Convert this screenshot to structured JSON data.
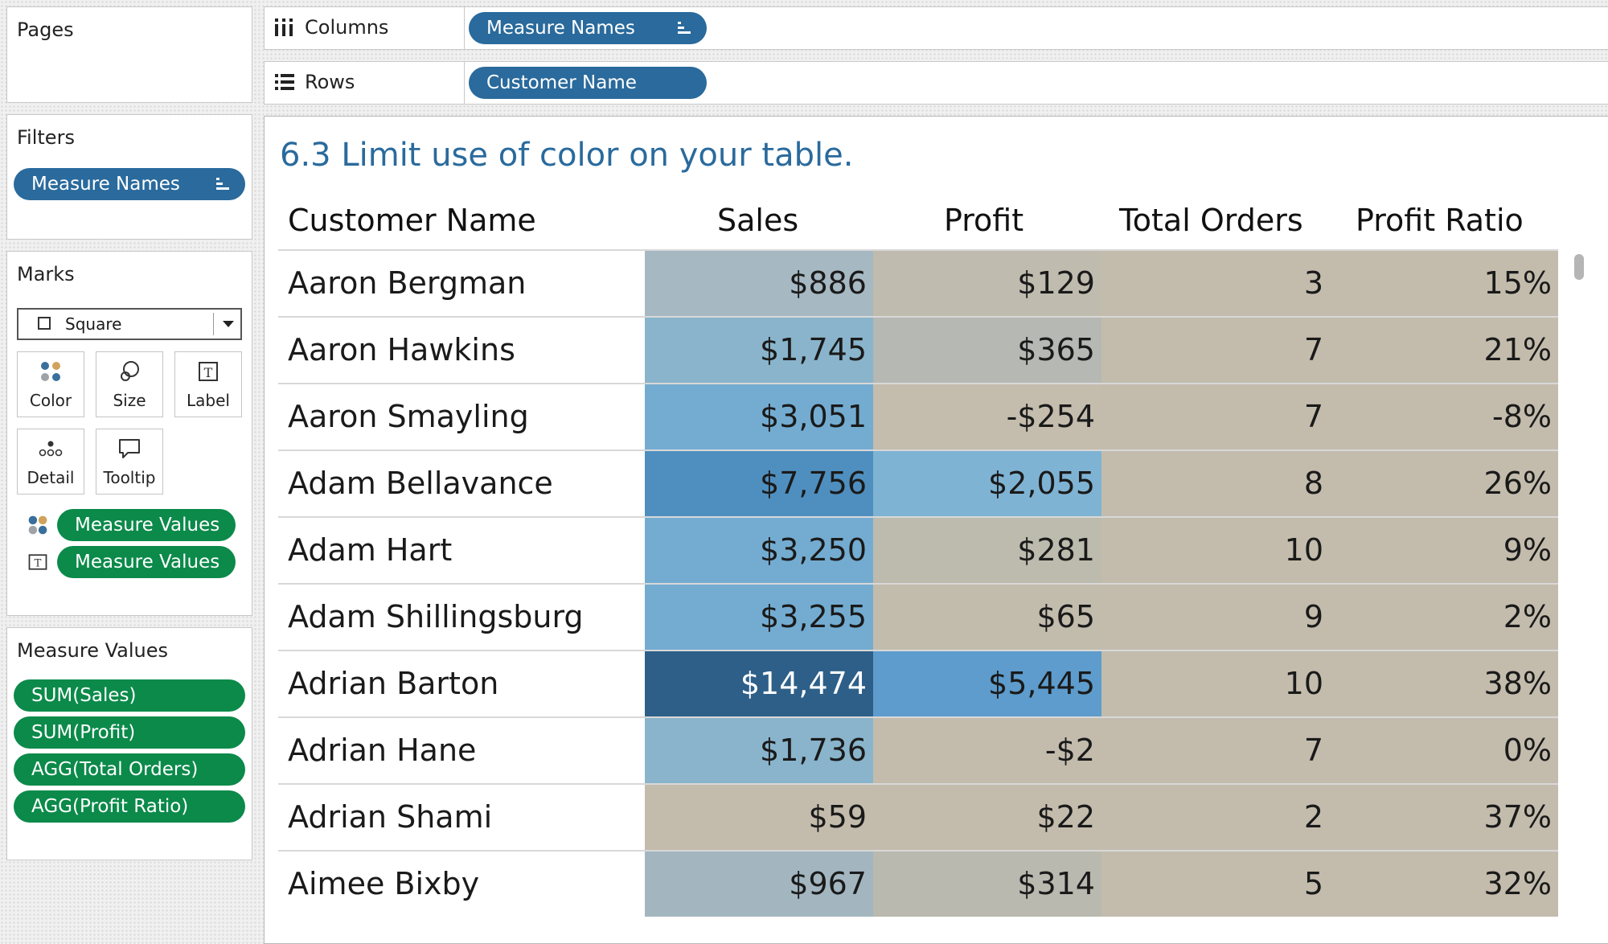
{
  "pages_panel": {
    "title": "Pages"
  },
  "filters_panel": {
    "title": "Filters",
    "pills": [
      "Measure Names"
    ]
  },
  "marks_panel": {
    "title": "Marks",
    "mark_type": "Square",
    "cards": [
      {
        "label": "Color",
        "icon": "color-dots-icon"
      },
      {
        "label": "Size",
        "icon": "size-icon"
      },
      {
        "label": "Label",
        "icon": "label-text-icon"
      },
      {
        "label": "Detail",
        "icon": "detail-dots-icon"
      },
      {
        "label": "Tooltip",
        "icon": "tooltip-icon"
      }
    ],
    "encodings": [
      {
        "icon": "color-dots-icon",
        "pill": "Measure Values"
      },
      {
        "icon": "label-text-icon",
        "pill": "Measure Values"
      }
    ]
  },
  "measure_values_panel": {
    "title": "Measure Values",
    "pills": [
      "SUM(Sales)",
      "SUM(Profit)",
      "AGG(Total Orders)",
      "AGG(Profit Ratio)"
    ]
  },
  "shelves": {
    "columns": {
      "label": "Columns",
      "pill": "Measure Names"
    },
    "rows": {
      "label": "Rows",
      "pill": "Customer Name"
    }
  },
  "viz": {
    "title": "6.3 Limit use of color on your table.",
    "headers": [
      "Customer Name",
      "Sales",
      "Profit",
      "Total Orders",
      "Profit Ratio"
    ],
    "rows": [
      {
        "name": "Aaron Bergman",
        "sales": "$886",
        "profit": "$129",
        "orders": "3",
        "ratio": "15%"
      },
      {
        "name": "Aaron Hawkins",
        "sales": "$1,745",
        "profit": "$365",
        "orders": "7",
        "ratio": "21%"
      },
      {
        "name": "Aaron Smayling",
        "sales": "$3,051",
        "profit": "-$254",
        "orders": "7",
        "ratio": "-8%"
      },
      {
        "name": "Adam Bellavance",
        "sales": "$7,756",
        "profit": "$2,055",
        "orders": "8",
        "ratio": "26%"
      },
      {
        "name": "Adam Hart",
        "sales": "$3,250",
        "profit": "$281",
        "orders": "10",
        "ratio": "9%"
      },
      {
        "name": "Adam Shillingsburg",
        "sales": "$3,255",
        "profit": "$65",
        "orders": "9",
        "ratio": "2%"
      },
      {
        "name": "Adrian Barton",
        "sales": "$14,474",
        "profit": "$5,445",
        "orders": "10",
        "ratio": "38%"
      },
      {
        "name": "Adrian Hane",
        "sales": "$1,736",
        "profit": "-$2",
        "orders": "7",
        "ratio": "0%"
      },
      {
        "name": "Adrian Shami",
        "sales": "$59",
        "profit": "$22",
        "orders": "2",
        "ratio": "37%"
      },
      {
        "name": "Aimee Bixby",
        "sales": "$967",
        "profit": "$314",
        "orders": "5",
        "ratio": "32%"
      }
    ],
    "cell_colors": [
      {
        "sales": "#a6b8c2",
        "profit": "#bfbbae"
      },
      {
        "sales": "#89b4cb",
        "profit": "#b5b8b3"
      },
      {
        "sales": "#74acd1",
        "profit": "#c4bcad"
      },
      {
        "sales": "#4f8fbf",
        "profit": "#7fb3d4"
      },
      {
        "sales": "#74acd1",
        "profit": "#bdbbae"
      },
      {
        "sales": "#74acd1",
        "profit": "#c2bcad"
      },
      {
        "sales": "#2d5f88",
        "profit": "#5d9ccc"
      },
      {
        "sales": "#89b4cb",
        "profit": "#c3bcad"
      },
      {
        "sales": "#c3bcad",
        "profit": "#c3bcad"
      },
      {
        "sales": "#a3b6c0",
        "profit": "#b9b9b0"
      }
    ],
    "neutral_color": "#c3bcad",
    "dark_cell_text_color": "#ffffff",
    "accent": "#2a6a9c",
    "pill_green": "#0b8a4a"
  }
}
